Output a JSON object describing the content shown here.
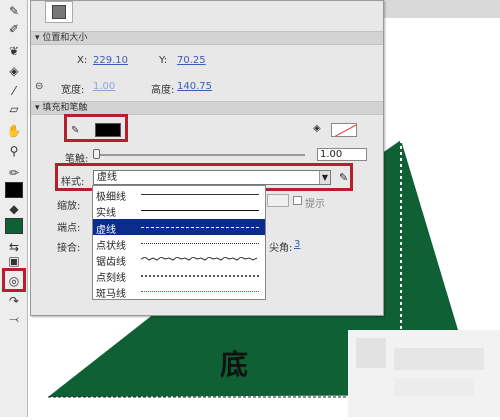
{
  "panel": {
    "section_position": "位置和大小",
    "x_label": "X:",
    "x_value": "229.10",
    "y_label": "Y:",
    "y_value": "70.25",
    "width_label": "宽度:",
    "width_value": "1.00",
    "height_label": "高度:",
    "height_value": "140.75",
    "section_fill": "填充和笔触",
    "stroke_color": "#000000",
    "hint_label": "笔触:",
    "hint_value": "1.00",
    "style_label": "样式:",
    "style_selected": "虚线",
    "scale_label": "缩放:",
    "hint_checkbox": "提示",
    "cap_label": "端点:",
    "join_label": "接合:",
    "miter_label": "尖角:",
    "miter_value": "3"
  },
  "style_options": [
    "极细线",
    "实线",
    "虚线",
    "点状线",
    "锯齿线",
    "点刻线",
    "斑马线"
  ],
  "style_selected_index": 2,
  "stage": {
    "shape_label": "底",
    "shape_color": "#0f6135"
  },
  "toolbar": {
    "fill_swatch": "#0f6135",
    "stroke_swatch": "#000000"
  }
}
